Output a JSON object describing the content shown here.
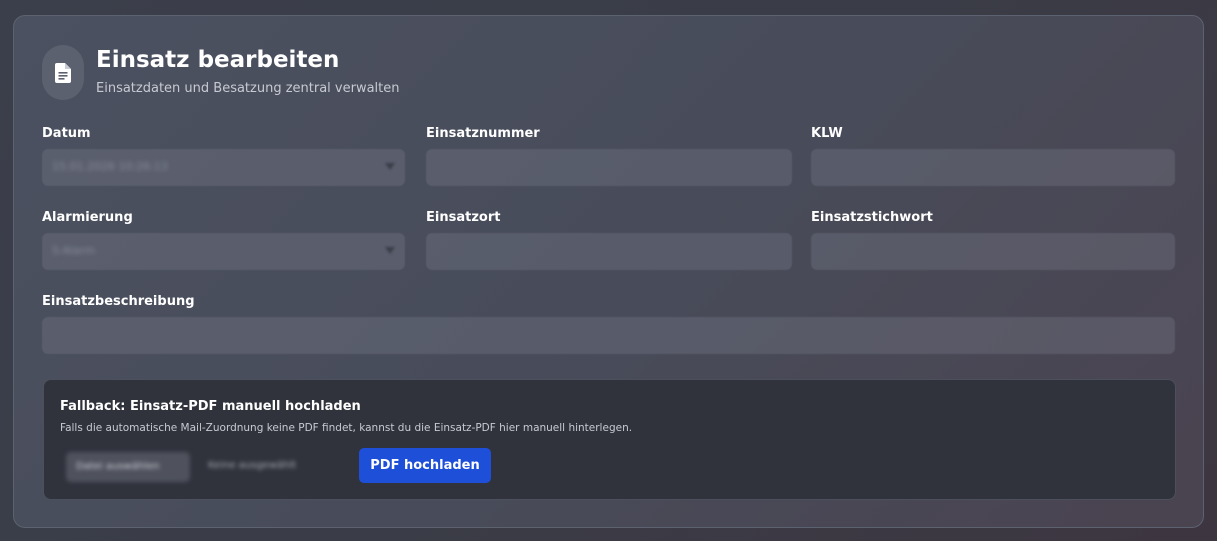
{
  "header": {
    "title": "Einsatz bearbeiten",
    "subtitle": "Einsatzdaten und Besatzung zentral verwalten",
    "icon": "document-icon"
  },
  "form": {
    "datum": {
      "label": "Datum",
      "value": "15.01.2026 10:26:13"
    },
    "einsatznummer": {
      "label": "Einsatznummer",
      "value": ""
    },
    "klw": {
      "label": "KLW",
      "value": ""
    },
    "alarmierung": {
      "label": "Alarmierung",
      "value": "S-Alarm"
    },
    "einsatzort": {
      "label": "Einsatzort",
      "value": ""
    },
    "einsatzstichwort": {
      "label": "Einsatzstichwort",
      "value": ""
    },
    "einsatzbeschreibung": {
      "label": "Einsatzbeschreibung",
      "value": ""
    }
  },
  "fallback": {
    "title": "Fallback: Einsatz-PDF manuell hochladen",
    "text": "Falls die automatische Mail-Zuordnung keine PDF findet, kannst du die Einsatz-PDF hier manuell hinterlegen.",
    "choose_label": "Datei auswählen",
    "file_status": "Keine ausgewählt",
    "upload_label": "PDF hochladen"
  },
  "colors": {
    "accent": "#1e4fd8",
    "card": "#4b5160",
    "panel": "#30333c"
  }
}
